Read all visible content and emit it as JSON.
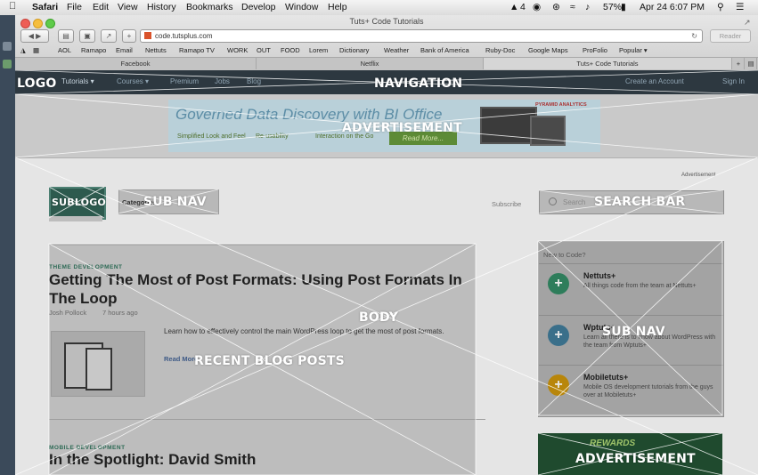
{
  "menubar": {
    "app": "Safari",
    "items": [
      "File",
      "Edit",
      "View",
      "History",
      "Bookmarks",
      "Develop",
      "Window",
      "Help"
    ],
    "status": {
      "notifications": "4",
      "battery": "57%",
      "datetime": "Apr 24  6:07 PM"
    }
  },
  "window": {
    "title": "Tuts+ Code Tutorials",
    "url": "code.tutsplus.com",
    "reader_label": "Reader"
  },
  "bookmarks": [
    "AOL",
    "Ramapo",
    "Email",
    "Nettuts",
    "Ramapo TV",
    "WORK",
    "OUT",
    "FOOD",
    "Lorem",
    "Dictionary",
    "Weather",
    "Bank of America",
    "Ruby-Doc",
    "Google Maps",
    "ProFolio",
    "Popular ▾"
  ],
  "tabs": [
    "Facebook",
    "Netflix",
    "Tuts+ Code Tutorials"
  ],
  "site_nav": {
    "items": [
      "Tutorials ▾",
      "Courses ▾",
      "Premium",
      "Jobs",
      "Blog"
    ],
    "right": [
      "Create an Account",
      "Sign In"
    ]
  },
  "ad": {
    "headline": "Governed Data Discovery with BI Office",
    "bullets": [
      "Simplified Look and Feel",
      "Re-usability",
      "Interaction on the Go"
    ],
    "cta": "Read More...",
    "brand": "PYRAMID ANALYTICS",
    "label": "Advertisement"
  },
  "subnav": {
    "category_text": "Categories",
    "subscribe": "Subscribe",
    "search_placeholder": "Search"
  },
  "posts": [
    {
      "category": "THEME DEVELOPMENT",
      "title": "Getting The Most of Post Formats: Using Post Formats In The Loop",
      "author": "Josh Pollock",
      "time": "7 hours ago",
      "excerpt": "Learn how to effectively control the main WordPress loop to get the most of post formats.",
      "read_more": "Read More"
    },
    {
      "category": "MOBILE DEVELOPMENT",
      "title": "In the Spotlight: David Smith"
    }
  ],
  "sidebar": {
    "title": "New to Code?",
    "items": [
      {
        "name": "Nettuts+",
        "desc": "All things code from the team at Nettuts+",
        "color": "#2e7d5b",
        "icon": "plus-icon"
      },
      {
        "name": "Wptuts+",
        "desc": "Learn all there is to know about WordPress with the team from Wptuts+",
        "color": "#3a6f8a",
        "icon": "plus-icon"
      },
      {
        "name": "Mobiletuts+",
        "desc": "Mobile OS development tutorials from the guys over at Mobiletuts+",
        "color": "#b8860b",
        "icon": "plus-icon"
      }
    ]
  },
  "ad2": {
    "text": "REWARDS"
  },
  "wireframe_labels": {
    "logo": "LOGO",
    "navigation": "NAVIGATION",
    "advertisement": "ADVERTISEMENT",
    "sublogo": "SUBLOGO",
    "sub_nav": "SUB NAV",
    "search_bar": "SEARCH BAR",
    "body": "BODY",
    "recent_posts": "RECENT BLOG POSTS",
    "sidebar_sub_nav": "SUB NAV",
    "advertisement2": "ADVERTISEMENT"
  }
}
